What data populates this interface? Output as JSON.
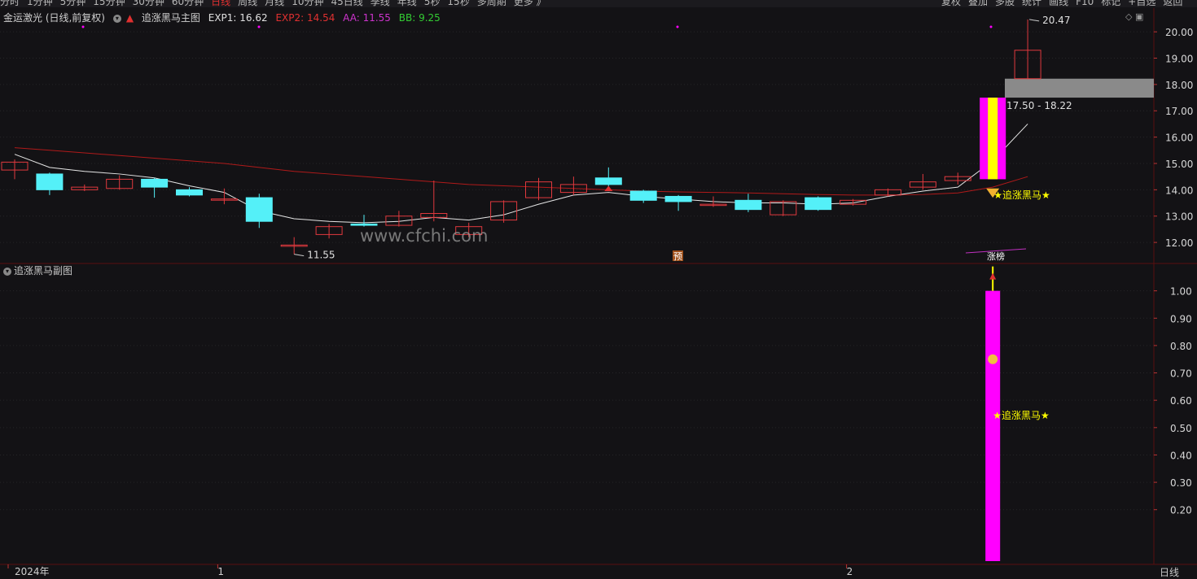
{
  "toolbar": {
    "items": [
      "分时",
      "1分钟",
      "5分钟",
      "15分钟",
      "30分钟",
      "60分钟",
      "日线",
      "周线",
      "月线",
      "10分钟",
      "45日线",
      "季线",
      "年线",
      "5秒",
      "15秒",
      "多周期",
      "更多 》"
    ],
    "active_index": 6,
    "right_items": [
      "复权",
      "叠加",
      "多股",
      "统计",
      "画线",
      "F10",
      "标记",
      "+自选",
      "返回"
    ]
  },
  "main_header": {
    "stock": "金运激光 (日线,前复权)",
    "indicator": "追涨黑马主图",
    "exp1": "EXP1: 16.62",
    "exp2": "EXP2: 14.54",
    "aa": "AA: 11.55",
    "bb": "BB: 9.25"
  },
  "sub_header": {
    "indicator": "追涨黑马副图"
  },
  "colors": {
    "up": "#e0393e",
    "down": "#54f0f8",
    "ma_white": "#e6e6e6",
    "ma_red": "#b01a1a",
    "magenta": "#ff00ff",
    "yellow": "#ffff00",
    "exp2_red": "#e03030",
    "aa_purple": "#cc33cc",
    "bb_green": "#33cc33"
  },
  "watermark": "www.cfchi.com",
  "annotations": {
    "high_label": "20.47",
    "low_label": "11.55",
    "range_label": "17.50 - 18.22",
    "signal_label": "★追涨黑马★",
    "pre_label": "预",
    "limit_label": "涨榜"
  },
  "period_label": "日线",
  "chart_data": [
    {
      "type": "candlestick",
      "y_ticks": [
        "20.00",
        "19.00",
        "18.00",
        "17.00",
        "16.00",
        "15.00",
        "14.00",
        "13.00",
        "12.00"
      ],
      "ylim": [
        11.2,
        20.9
      ],
      "x_labels": [
        {
          "text": "2024年",
          "index": 0
        },
        {
          "text": "1",
          "index": 6
        },
        {
          "text": "2",
          "index": 24
        }
      ],
      "candles": [
        {
          "o": 14.75,
          "h": 15.15,
          "l": 14.4,
          "c": 15.05
        },
        {
          "o": 14.6,
          "h": 14.65,
          "l": 13.8,
          "c": 14.0
        },
        {
          "o": 14.0,
          "h": 14.2,
          "l": 13.95,
          "c": 14.1
        },
        {
          "o": 14.05,
          "h": 14.55,
          "l": 14.0,
          "c": 14.4
        },
        {
          "o": 14.4,
          "h": 14.45,
          "l": 13.7,
          "c": 14.1
        },
        {
          "o": 14.0,
          "h": 14.1,
          "l": 13.75,
          "c": 13.8
        },
        {
          "o": 13.65,
          "h": 14.05,
          "l": 13.45,
          "c": 13.65
        },
        {
          "o": 13.7,
          "h": 13.85,
          "l": 12.55,
          "c": 12.8
        },
        {
          "o": 11.9,
          "h": 12.2,
          "l": 11.55,
          "c": 11.9
        },
        {
          "o": 12.3,
          "h": 12.7,
          "l": 12.15,
          "c": 12.6
        },
        {
          "o": 12.7,
          "h": 13.05,
          "l": 12.6,
          "c": 12.65
        },
        {
          "o": 12.65,
          "h": 13.2,
          "l": 12.6,
          "c": 13.0
        },
        {
          "o": 12.95,
          "h": 14.35,
          "l": 12.8,
          "c": 13.1
        },
        {
          "o": 12.3,
          "h": 12.75,
          "l": 12.2,
          "c": 12.6
        },
        {
          "o": 12.85,
          "h": 13.6,
          "l": 12.75,
          "c": 13.55
        },
        {
          "o": 13.7,
          "h": 14.45,
          "l": 13.6,
          "c": 14.3
        },
        {
          "o": 13.9,
          "h": 14.5,
          "l": 13.8,
          "c": 14.2
        },
        {
          "o": 14.45,
          "h": 14.85,
          "l": 14.0,
          "c": 14.2
        },
        {
          "o": 13.95,
          "h": 14.0,
          "l": 13.5,
          "c": 13.6
        },
        {
          "o": 13.75,
          "h": 13.8,
          "l": 13.2,
          "c": 13.55
        },
        {
          "o": 13.45,
          "h": 13.75,
          "l": 13.35,
          "c": 13.45
        },
        {
          "o": 13.6,
          "h": 13.85,
          "l": 13.15,
          "c": 13.25
        },
        {
          "o": 13.05,
          "h": 13.6,
          "l": 13.0,
          "c": 13.55
        },
        {
          "o": 13.7,
          "h": 13.75,
          "l": 13.2,
          "c": 13.25
        },
        {
          "o": 13.45,
          "h": 13.65,
          "l": 13.4,
          "c": 13.6
        },
        {
          "o": 13.8,
          "h": 14.05,
          "l": 13.75,
          "c": 14.0
        },
        {
          "o": 14.1,
          "h": 14.6,
          "l": 14.0,
          "c": 14.3
        },
        {
          "o": 14.35,
          "h": 14.65,
          "l": 14.2,
          "c": 14.5
        },
        {
          "o": 14.4,
          "h": 17.5,
          "l": 14.4,
          "c": 17.5
        },
        {
          "o": 18.22,
          "h": 20.47,
          "l": 18.2,
          "c": 19.3
        }
      ],
      "ma_white": [
        15.35,
        14.85,
        14.7,
        14.6,
        14.45,
        14.15,
        13.9,
        13.2,
        12.9,
        12.8,
        12.75,
        12.8,
        12.95,
        12.85,
        13.05,
        13.45,
        13.8,
        13.9,
        13.75,
        13.65,
        13.55,
        13.5,
        13.5,
        13.45,
        13.5,
        13.75,
        13.95,
        14.1,
        15.1,
        16.5
      ],
      "ma_red": [
        15.6,
        15.5,
        15.4,
        15.3,
        15.2,
        15.1,
        15.0,
        14.85,
        14.7,
        14.6,
        14.5,
        14.4,
        14.3,
        14.2,
        14.15,
        14.1,
        14.05,
        14.0,
        13.95,
        13.92,
        13.9,
        13.88,
        13.85,
        13.82,
        13.8,
        13.8,
        13.82,
        13.88,
        14.1,
        14.5
      ],
      "range_zone": [
        17.5,
        18.22
      ]
    },
    {
      "type": "bar",
      "y_ticks": [
        "1.00",
        "0.90",
        "0.80",
        "0.70",
        "0.60",
        "0.50",
        "0.40",
        "0.30",
        "0.20"
      ],
      "ylim": [
        0,
        1.1
      ],
      "signal_index": 28,
      "signal_value": 1.0
    }
  ]
}
